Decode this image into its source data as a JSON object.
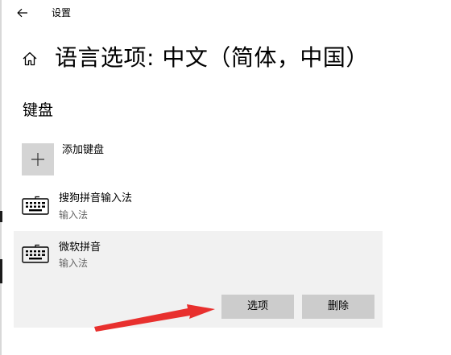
{
  "titlebar": {
    "app_title": "设置",
    "back_icon": "back-arrow-icon"
  },
  "header": {
    "home_icon": "home-icon",
    "title": "语言选项: 中文（简体，中国）"
  },
  "keyboard_section": {
    "title": "键盘",
    "add_keyboard_label": "添加键盘",
    "add_icon": "plus-icon",
    "items": [
      {
        "name": "搜狗拼音输入法",
        "type": "输入法",
        "icon": "keyboard-icon",
        "selected": false
      },
      {
        "name": "微软拼音",
        "type": "输入法",
        "icon": "keyboard-icon",
        "selected": true
      }
    ],
    "options_button": "选项",
    "remove_button": "删除"
  },
  "annotation": {
    "arrow_color": "#e8302e"
  },
  "colors": {
    "tile_gray": "#d4d4d4",
    "selected_bg": "#f1f1f1",
    "button_gray": "#cccccc",
    "secondary_text": "#666666"
  }
}
